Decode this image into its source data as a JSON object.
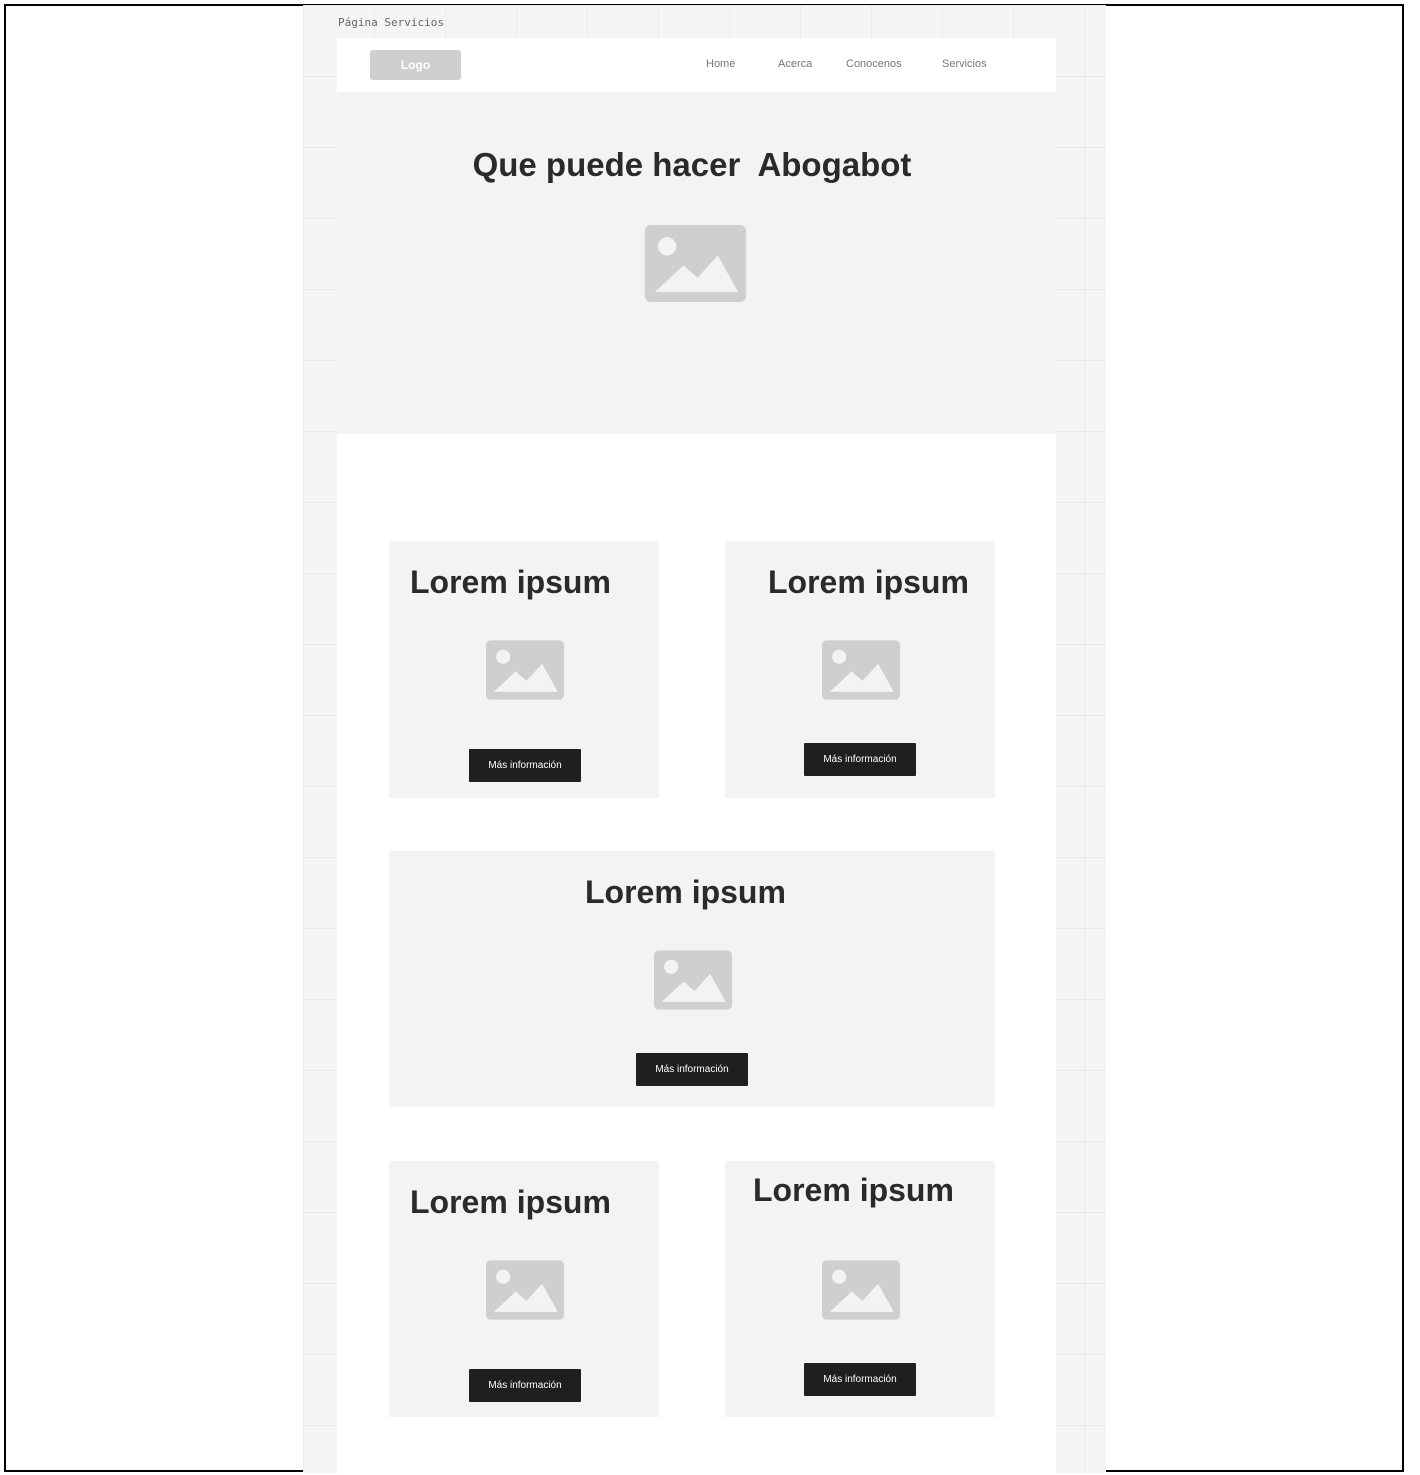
{
  "frame_label": "Página Servicios",
  "navbar": {
    "logo": "Logo",
    "links": [
      "Home",
      "Acerca",
      "Conocenos",
      "Servicios"
    ]
  },
  "hero": {
    "title": "Que puede hacer  Abogabot"
  },
  "cards": [
    {
      "title": "Lorem ipsum",
      "button": "Más información"
    },
    {
      "title": "Lorem ipsum",
      "button": "Más información"
    },
    {
      "title": "Lorem ipsum",
      "button": "Más información"
    },
    {
      "title": "Lorem ipsum",
      "button": "Más información"
    },
    {
      "title": "Lorem ipsum",
      "button": "Más información"
    }
  ],
  "colors": {
    "background": "#f5f5f5",
    "panel": "#f3f3f3",
    "button": "#1f1f1f",
    "placeholder": "#cfcfcf"
  }
}
